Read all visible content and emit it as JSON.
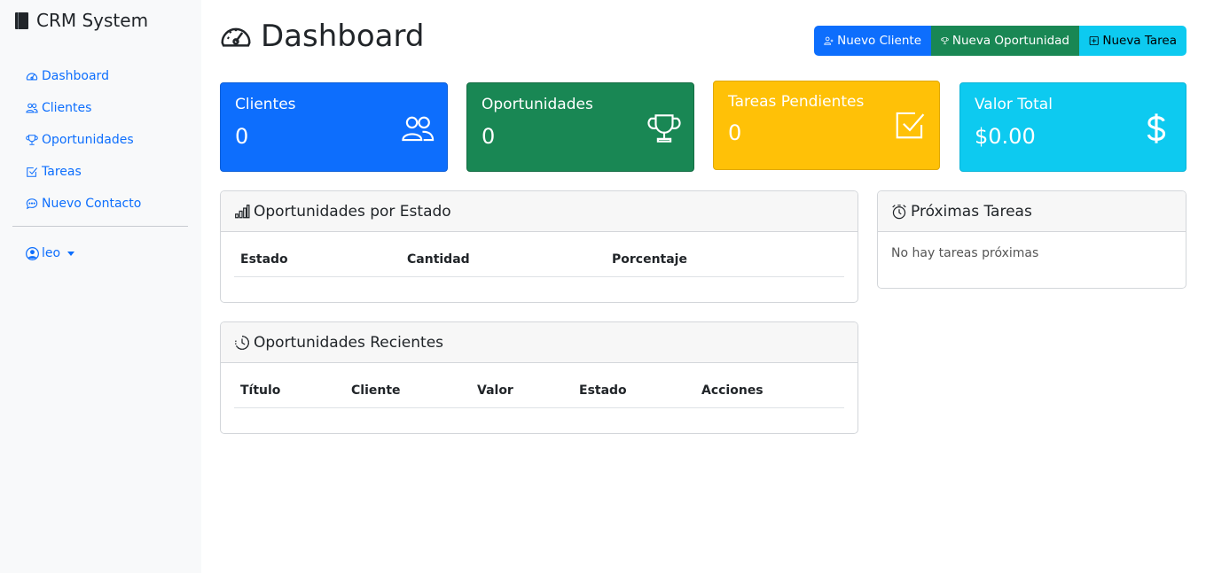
{
  "sidebar": {
    "brand": "CRM System",
    "items": [
      {
        "label": "Dashboard",
        "icon": "speedometer-icon"
      },
      {
        "label": "Clientes",
        "icon": "people-icon"
      },
      {
        "label": "Oportunidades",
        "icon": "trophy-icon"
      },
      {
        "label": "Tareas",
        "icon": "check-square-icon"
      },
      {
        "label": "Nuevo Contacto",
        "icon": "chat-dots-icon"
      }
    ],
    "user": "leo"
  },
  "header": {
    "title": "Dashboard",
    "buttons": {
      "nuevo_cliente": "Nuevo Cliente",
      "nueva_oportunidad": "Nueva Oportunidad",
      "nueva_tarea": "Nueva Tarea"
    }
  },
  "stats": {
    "clientes": {
      "label": "Clientes",
      "value": "0"
    },
    "oportunidades": {
      "label": "Oportunidades",
      "value": "0"
    },
    "tareas": {
      "label": "Tareas Pendientes",
      "value": "0"
    },
    "valor": {
      "label": "Valor Total",
      "value": "$0.00"
    }
  },
  "cards": {
    "por_estado": {
      "title": "Oportunidades por Estado",
      "columns": [
        "Estado",
        "Cantidad",
        "Porcentaje"
      ]
    },
    "recientes": {
      "title": "Oportunidades Recientes",
      "columns": [
        "Título",
        "Cliente",
        "Valor",
        "Estado",
        "Acciones"
      ]
    },
    "proximas": {
      "title": "Próximas Tareas",
      "empty": "No hay tareas próximas"
    }
  },
  "colors": {
    "primary": "#0d6efd",
    "success": "#198754",
    "warning": "#ffc107",
    "info": "#0dcaf0",
    "sidebar_bg": "#f8f9fa"
  }
}
